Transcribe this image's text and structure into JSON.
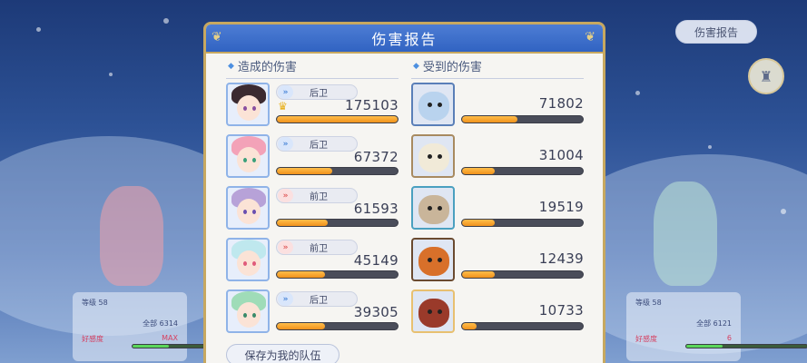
{
  "top_right_button": "伤害报告",
  "background_cards": [
    {
      "line1": "等级 58",
      "line2": "全部 6314",
      "line3": "好感度",
      "line4": "MAX"
    },
    {
      "line1": "等级 58",
      "line2": "全部 6121",
      "line3": "好感度",
      "line4": "6"
    }
  ],
  "dialog": {
    "title": "伤害报告",
    "dealt": {
      "title": "造成的伤害",
      "rows": [
        {
          "role": "后卫",
          "role_type": "back",
          "value": "175103",
          "fill": 1.0,
          "crown": true,
          "palette": {
            "hair": "#3b2a30",
            "eye": "#8a4fa0"
          }
        },
        {
          "role": "后卫",
          "role_type": "back",
          "value": "67372",
          "fill": 0.46,
          "crown": false,
          "palette": {
            "hair": "#f3a2b8",
            "eye": "#3aa07a"
          }
        },
        {
          "role": "前卫",
          "role_type": "front",
          "value": "61593",
          "fill": 0.42,
          "crown": false,
          "palette": {
            "hair": "#b7a2d8",
            "eye": "#6a4fb0"
          }
        },
        {
          "role": "前卫",
          "role_type": "front",
          "value": "45149",
          "fill": 0.4,
          "crown": false,
          "palette": {
            "hair": "#bfe8ee",
            "eye": "#e05a7a"
          }
        },
        {
          "role": "后卫",
          "role_type": "back",
          "value": "39305",
          "fill": 0.4,
          "crown": false,
          "palette": {
            "hair": "#9fdcb8",
            "eye": "#3a8a6a"
          }
        }
      ]
    },
    "received": {
      "title": "受到的伤害",
      "rows": [
        {
          "value": "71802",
          "fill": 0.46,
          "palette": {
            "body": "#b9d3ee",
            "accent": "#5a7fb8"
          }
        },
        {
          "value": "31004",
          "fill": 0.27,
          "palette": {
            "body": "#f1ead8",
            "accent": "#a88a60"
          }
        },
        {
          "value": "19519",
          "fill": 0.27,
          "palette": {
            "body": "#c9b59a",
            "accent": "#4aa0c0"
          }
        },
        {
          "value": "12439",
          "fill": 0.27,
          "palette": {
            "body": "#d8702a",
            "accent": "#6a4a30"
          }
        },
        {
          "value": "10733",
          "fill": 0.12,
          "palette": {
            "body": "#9a3a2a",
            "accent": "#e8c070"
          }
        }
      ]
    },
    "save_button": "保存为我的队伍"
  }
}
